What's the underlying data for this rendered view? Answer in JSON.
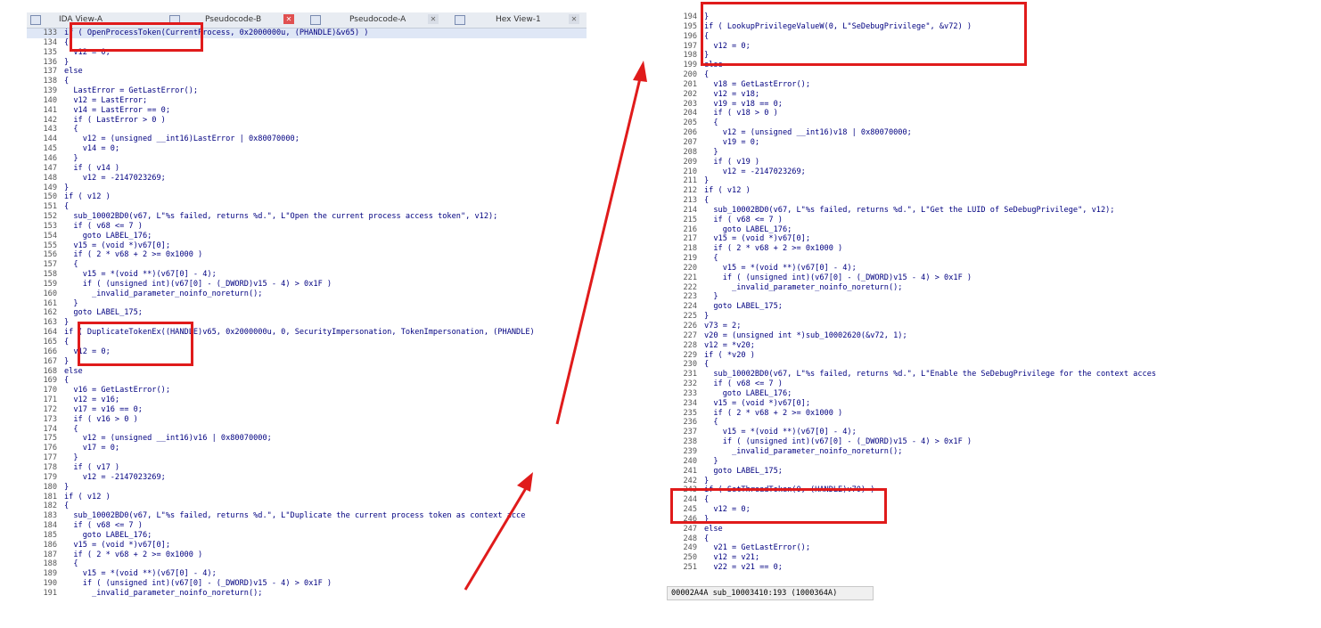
{
  "left": {
    "tabs": [
      "IDA View-A",
      "Pseudocode-B",
      "Pseudocode-A",
      "Hex View-1"
    ],
    "lines": [
      {
        "n": "133",
        "bp": true,
        "cur": true,
        "t": "if ( OpenProcessToken(CurrentProcess, 0x2000000u, (PHANDLE)&v65) )"
      },
      {
        "n": "134",
        "bp": false,
        "t": "{"
      },
      {
        "n": "135",
        "bp": true,
        "t": "  v12 = 0;"
      },
      {
        "n": "136",
        "bp": false,
        "t": "}"
      },
      {
        "n": "137",
        "bp": false,
        "t": "else"
      },
      {
        "n": "138",
        "bp": false,
        "t": "{"
      },
      {
        "n": "139",
        "bp": true,
        "t": "  LastError = GetLastError();"
      },
      {
        "n": "140",
        "bp": true,
        "t": "  v12 = LastError;"
      },
      {
        "n": "141",
        "bp": true,
        "t": "  v14 = LastError == 0;"
      },
      {
        "n": "142",
        "bp": true,
        "t": "  if ( LastError > 0 )"
      },
      {
        "n": "143",
        "bp": false,
        "t": "  {"
      },
      {
        "n": "144",
        "bp": true,
        "t": "    v12 = (unsigned __int16)LastError | 0x80070000;"
      },
      {
        "n": "145",
        "bp": true,
        "t": "    v14 = 0;"
      },
      {
        "n": "146",
        "bp": false,
        "t": "  }"
      },
      {
        "n": "147",
        "bp": true,
        "t": "  if ( v14 )"
      },
      {
        "n": "148",
        "bp": true,
        "t": "    v12 = -2147023269;"
      },
      {
        "n": "149",
        "bp": false,
        "t": "}"
      },
      {
        "n": "150",
        "bp": true,
        "t": "if ( v12 )"
      },
      {
        "n": "151",
        "bp": false,
        "t": "{"
      },
      {
        "n": "152",
        "bp": true,
        "t": "  sub_10002BD0(v67, L\"%s failed, returns %d.\", L\"Open the current process access token\", v12);"
      },
      {
        "n": "153",
        "bp": true,
        "t": "  if ( v68 <= 7 )"
      },
      {
        "n": "154",
        "bp": true,
        "t": "    goto LABEL_176;"
      },
      {
        "n": "155",
        "bp": true,
        "t": "  v15 = (void *)v67[0];"
      },
      {
        "n": "156",
        "bp": true,
        "t": "  if ( 2 * v68 + 2 >= 0x1000 )"
      },
      {
        "n": "157",
        "bp": false,
        "t": "  {"
      },
      {
        "n": "158",
        "bp": true,
        "t": "    v15 = *(void **)(v67[0] - 4);"
      },
      {
        "n": "159",
        "bp": true,
        "t": "    if ( (unsigned int)(v67[0] - (_DWORD)v15 - 4) > 0x1F )"
      },
      {
        "n": "160",
        "bp": true,
        "t": "      _invalid_parameter_noinfo_noreturn();"
      },
      {
        "n": "161",
        "bp": false,
        "t": "  }"
      },
      {
        "n": "162",
        "bp": true,
        "t": "  goto LABEL_175;"
      },
      {
        "n": "163",
        "bp": false,
        "t": "}"
      },
      {
        "n": "164",
        "bp": true,
        "t": "if ( DuplicateTokenEx((HANDLE)v65, 0x2000000u, 0, SecurityImpersonation, TokenImpersonation, (PHANDLE)"
      },
      {
        "n": "165",
        "bp": false,
        "t": "{"
      },
      {
        "n": "166",
        "bp": true,
        "t": "  v12 = 0;"
      },
      {
        "n": "167",
        "bp": false,
        "t": "}"
      },
      {
        "n": "168",
        "bp": false,
        "t": "else"
      },
      {
        "n": "169",
        "bp": false,
        "t": "{"
      },
      {
        "n": "170",
        "bp": true,
        "t": "  v16 = GetLastError();"
      },
      {
        "n": "171",
        "bp": true,
        "t": "  v12 = v16;"
      },
      {
        "n": "172",
        "bp": true,
        "t": "  v17 = v16 == 0;"
      },
      {
        "n": "173",
        "bp": true,
        "t": "  if ( v16 > 0 )"
      },
      {
        "n": "174",
        "bp": false,
        "t": "  {"
      },
      {
        "n": "175",
        "bp": true,
        "t": "    v12 = (unsigned __int16)v16 | 0x80070000;"
      },
      {
        "n": "176",
        "bp": true,
        "t": "    v17 = 0;"
      },
      {
        "n": "177",
        "bp": false,
        "t": "  }"
      },
      {
        "n": "178",
        "bp": true,
        "t": "  if ( v17 )"
      },
      {
        "n": "179",
        "bp": true,
        "t": "    v12 = -2147023269;"
      },
      {
        "n": "180",
        "bp": false,
        "t": "}"
      },
      {
        "n": "181",
        "bp": true,
        "t": "if ( v12 )"
      },
      {
        "n": "182",
        "bp": false,
        "t": "{"
      },
      {
        "n": "183",
        "bp": true,
        "t": "  sub_10002BD0(v67, L\"%s failed, returns %d.\", L\"Duplicate the current process token as context acce"
      },
      {
        "n": "184",
        "bp": true,
        "t": "  if ( v68 <= 7 )"
      },
      {
        "n": "185",
        "bp": true,
        "t": "    goto LABEL_176;"
      },
      {
        "n": "186",
        "bp": true,
        "t": "  v15 = (void *)v67[0];"
      },
      {
        "n": "187",
        "bp": true,
        "t": "  if ( 2 * v68 + 2 >= 0x1000 )"
      },
      {
        "n": "188",
        "bp": false,
        "t": "  {"
      },
      {
        "n": "189",
        "bp": true,
        "t": "    v15 = *(void **)(v67[0] - 4);"
      },
      {
        "n": "190",
        "bp": true,
        "t": "    if ( (unsigned int)(v67[0] - (_DWORD)v15 - 4) > 0x1F )"
      },
      {
        "n": "191",
        "bp": true,
        "t": "      _invalid_parameter_noinfo_noreturn();"
      }
    ]
  },
  "right": {
    "lines": [
      {
        "n": "194",
        "bp": false,
        "t": "}"
      },
      {
        "n": "195",
        "bp": true,
        "t": "if ( LookupPrivilegeValueW(0, L\"SeDebugPrivilege\", &v72) )"
      },
      {
        "n": "196",
        "bp": false,
        "t": "{"
      },
      {
        "n": "197",
        "bp": true,
        "t": "  v12 = 0;"
      },
      {
        "n": "198",
        "bp": false,
        "t": "}"
      },
      {
        "n": "199",
        "bp": false,
        "t": "else"
      },
      {
        "n": "200",
        "bp": false,
        "t": "{"
      },
      {
        "n": "201",
        "bp": true,
        "t": "  v18 = GetLastError();"
      },
      {
        "n": "202",
        "bp": true,
        "t": "  v12 = v18;"
      },
      {
        "n": "203",
        "bp": true,
        "t": "  v19 = v18 == 0;"
      },
      {
        "n": "204",
        "bp": true,
        "t": "  if ( v18 > 0 )"
      },
      {
        "n": "205",
        "bp": false,
        "t": "  {"
      },
      {
        "n": "206",
        "bp": true,
        "t": "    v12 = (unsigned __int16)v18 | 0x80070000;"
      },
      {
        "n": "207",
        "bp": true,
        "t": "    v19 = 0;"
      },
      {
        "n": "208",
        "bp": false,
        "t": "  }"
      },
      {
        "n": "209",
        "bp": true,
        "t": "  if ( v19 )"
      },
      {
        "n": "210",
        "bp": true,
        "t": "    v12 = -2147023269;"
      },
      {
        "n": "211",
        "bp": false,
        "t": "}"
      },
      {
        "n": "212",
        "bp": true,
        "t": "if ( v12 )"
      },
      {
        "n": "213",
        "bp": false,
        "t": "{"
      },
      {
        "n": "214",
        "bp": true,
        "t": "  sub_10002BD0(v67, L\"%s failed, returns %d.\", L\"Get the LUID of SeDebugPrivilege\", v12);"
      },
      {
        "n": "215",
        "bp": true,
        "t": "  if ( v68 <= 7 )"
      },
      {
        "n": "216",
        "bp": true,
        "t": "    goto LABEL_176;"
      },
      {
        "n": "217",
        "bp": true,
        "t": "  v15 = (void *)v67[0];"
      },
      {
        "n": "218",
        "bp": true,
        "t": "  if ( 2 * v68 + 2 >= 0x1000 )"
      },
      {
        "n": "219",
        "bp": false,
        "t": "  {"
      },
      {
        "n": "220",
        "bp": true,
        "t": "    v15 = *(void **)(v67[0] - 4);"
      },
      {
        "n": "221",
        "bp": true,
        "t": "    if ( (unsigned int)(v67[0] - (_DWORD)v15 - 4) > 0x1F )"
      },
      {
        "n": "222",
        "bp": true,
        "t": "      _invalid_parameter_noinfo_noreturn();"
      },
      {
        "n": "223",
        "bp": false,
        "t": "  }"
      },
      {
        "n": "224",
        "bp": true,
        "t": "  goto LABEL_175;"
      },
      {
        "n": "225",
        "bp": false,
        "t": "}"
      },
      {
        "n": "226",
        "bp": true,
        "t": "v73 = 2;"
      },
      {
        "n": "227",
        "bp": true,
        "t": "v20 = (unsigned int *)sub_10002620(&v72, 1);"
      },
      {
        "n": "228",
        "bp": true,
        "t": "v12 = *v20;"
      },
      {
        "n": "229",
        "bp": true,
        "t": "if ( *v20 )"
      },
      {
        "n": "230",
        "bp": false,
        "t": "{"
      },
      {
        "n": "231",
        "bp": true,
        "t": "  sub_10002BD0(v67, L\"%s failed, returns %d.\", L\"Enable the SeDebugPrivilege for the context acces"
      },
      {
        "n": "232",
        "bp": true,
        "t": "  if ( v68 <= 7 )"
      },
      {
        "n": "233",
        "bp": true,
        "t": "    goto LABEL_176;"
      },
      {
        "n": "234",
        "bp": true,
        "t": "  v15 = (void *)v67[0];"
      },
      {
        "n": "235",
        "bp": true,
        "t": "  if ( 2 * v68 + 2 >= 0x1000 )"
      },
      {
        "n": "236",
        "bp": false,
        "t": "  {"
      },
      {
        "n": "237",
        "bp": true,
        "t": "    v15 = *(void **)(v67[0] - 4);"
      },
      {
        "n": "238",
        "bp": true,
        "t": "    if ( (unsigned int)(v67[0] - (_DWORD)v15 - 4) > 0x1F )"
      },
      {
        "n": "239",
        "bp": true,
        "t": "      _invalid_parameter_noinfo_noreturn();"
      },
      {
        "n": "240",
        "bp": false,
        "t": "  }"
      },
      {
        "n": "241",
        "bp": true,
        "t": "  goto LABEL_175;"
      },
      {
        "n": "242",
        "bp": false,
        "t": "}"
      },
      {
        "n": "243",
        "bp": true,
        "t": "if ( SetThreadToken(0, (HANDLE)v70) )"
      },
      {
        "n": "244",
        "bp": false,
        "t": "{"
      },
      {
        "n": "245",
        "bp": true,
        "t": "  v12 = 0;"
      },
      {
        "n": "246",
        "bp": false,
        "t": "}"
      },
      {
        "n": "247",
        "bp": false,
        "t": "else"
      },
      {
        "n": "248",
        "bp": false,
        "t": "{"
      },
      {
        "n": "249",
        "bp": true,
        "t": "  v21 = GetLastError();"
      },
      {
        "n": "250",
        "bp": true,
        "t": "  v12 = v21;"
      },
      {
        "n": "251",
        "bp": true,
        "t": "  v22 = v21 == 0;"
      }
    ],
    "status": "00002A4A sub_10003410:193 (1000364A)"
  },
  "colors": {
    "highlight": "#e01b1b",
    "code": "#000080",
    "arrow": "#e01b1b"
  }
}
